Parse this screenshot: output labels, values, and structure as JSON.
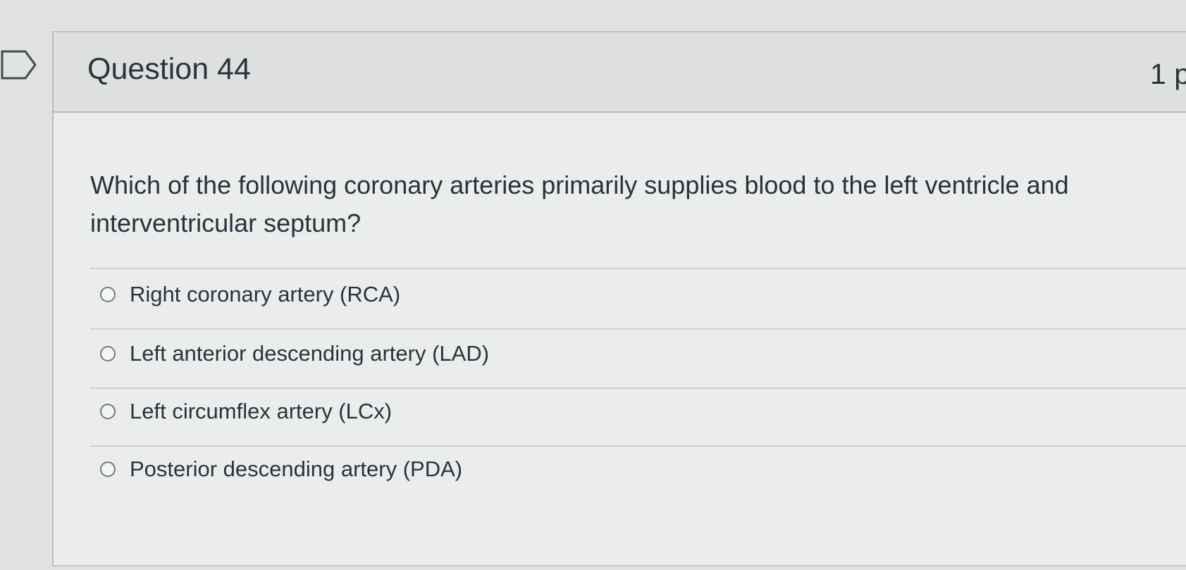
{
  "question": {
    "title": "Question 44",
    "points": "1 p",
    "text": "Which of the following coronary arteries primarily supplies blood to the left ventricle and interventricular septum?"
  },
  "answers": [
    {
      "label": "Right coronary artery (RCA)",
      "selected": false
    },
    {
      "label": "Left anterior descending artery (LAD)",
      "selected": false
    },
    {
      "label": "Left circumflex artery (LCx)",
      "selected": false
    },
    {
      "label": "Posterior descending artery (PDA)",
      "selected": false
    }
  ],
  "icons": {
    "flag": "flag-question-icon",
    "radio": "radio-button-icon"
  },
  "colors": {
    "background": "#dfe2e1",
    "card": "#ebeded",
    "header": "#dde0df",
    "text": "#2d3b45"
  }
}
